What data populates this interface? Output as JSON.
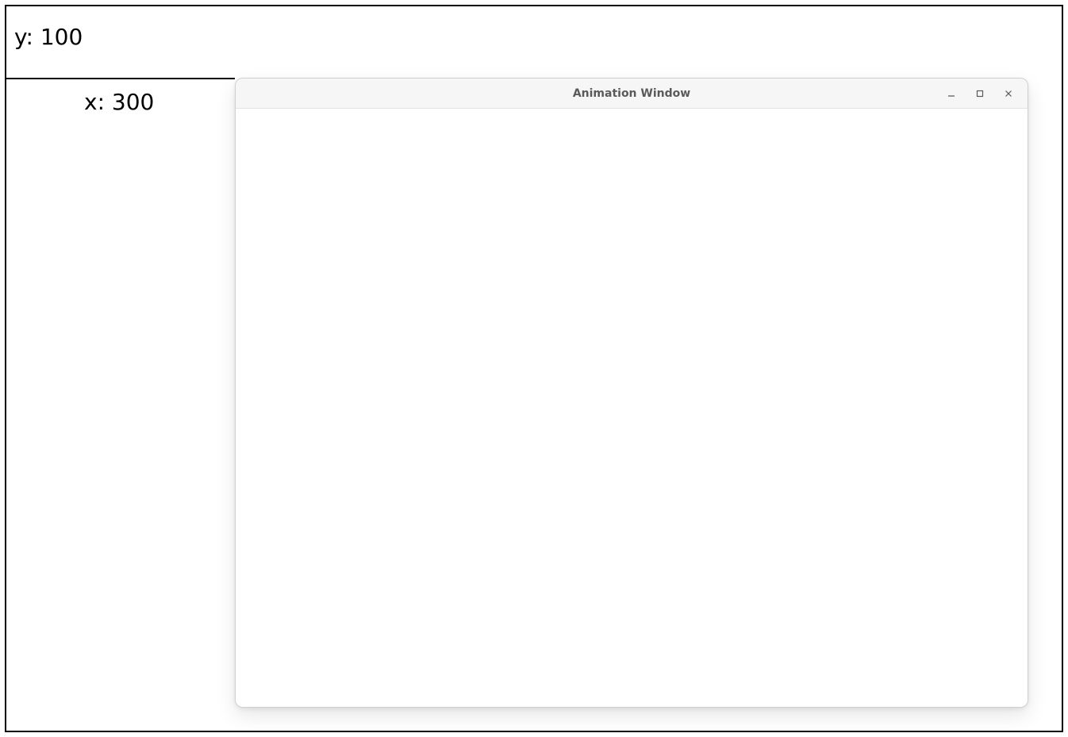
{
  "diagram": {
    "y_label": "y: 100",
    "x_label": "x: 300"
  },
  "window": {
    "title": "Animation Window"
  }
}
